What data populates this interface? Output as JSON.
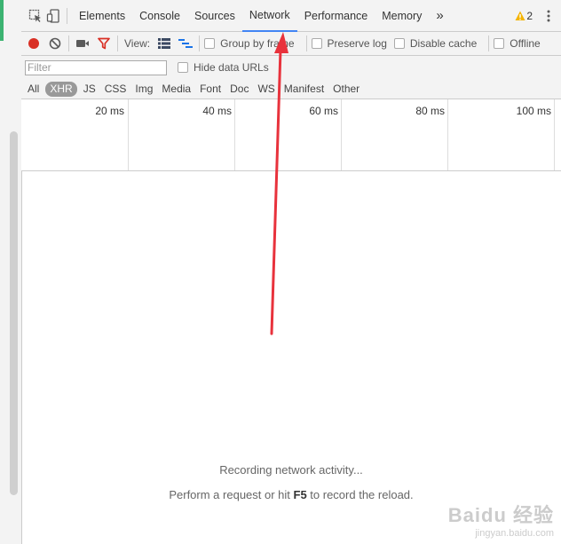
{
  "tabs": [
    {
      "label": "Elements"
    },
    {
      "label": "Console"
    },
    {
      "label": "Sources"
    },
    {
      "label": "Network",
      "active": true
    },
    {
      "label": "Performance"
    },
    {
      "label": "Memory"
    }
  ],
  "more_tabs_glyph": "»",
  "warnings": {
    "count": "2",
    "color": "#f4b400"
  },
  "toolbar": {
    "view_label": "View:",
    "group_by_frame": "Group by frame",
    "preserve_log": "Preserve log",
    "disable_cache": "Disable cache",
    "offline": "Offline"
  },
  "filter": {
    "placeholder": "Filter",
    "hide_data_urls": "Hide data URLs"
  },
  "types": [
    "All",
    "XHR",
    "JS",
    "CSS",
    "Img",
    "Media",
    "Font",
    "Doc",
    "WS",
    "Manifest",
    "Other"
  ],
  "selected_type": "XHR",
  "timeline": {
    "ticks": [
      "20 ms",
      "40 ms",
      "60 ms",
      "80 ms",
      "100 ms"
    ]
  },
  "empty_state": {
    "line1": "Recording network activity...",
    "line2_prefix": "Perform a request or hit ",
    "line2_key": "F5",
    "line2_suffix": " to record the reload."
  },
  "watermark": {
    "text": "Baidu 经验",
    "sub": "jingyan.baidu.com"
  },
  "colors": {
    "record": "#d93025",
    "filter_icon": "#d93025",
    "accent": "#4285f4",
    "annotation_arrow": "#e8323c"
  }
}
